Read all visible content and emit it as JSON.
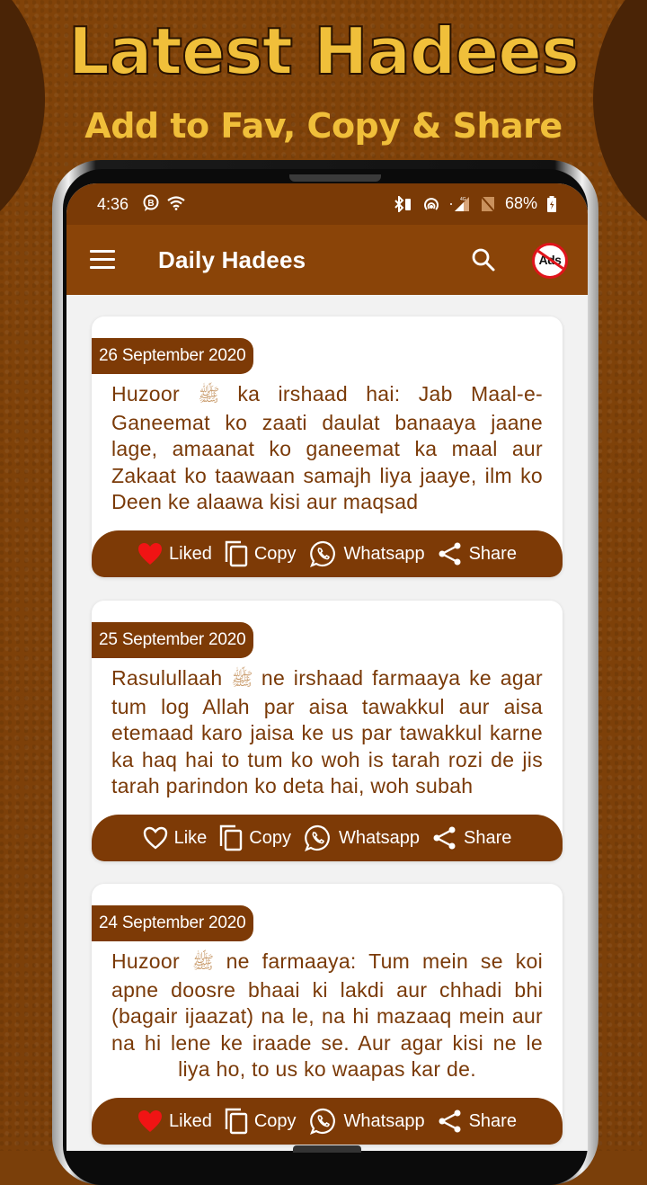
{
  "promo": {
    "title": "Latest Hadees",
    "subtitle": "Add to Fav, Copy & Share"
  },
  "status_bar": {
    "time": "4:36",
    "battery": "68%",
    "left_icons": [
      "chat-bubble-b-icon",
      "wifi-icon"
    ],
    "right_icons": [
      "bluetooth-icon",
      "hotspot-icon",
      "signal-icon",
      "no-sim-icon",
      "battery-charging-icon"
    ]
  },
  "app_bar": {
    "title": "Daily Hadees",
    "menu_icon": "hamburger-menu-icon",
    "search_icon": "search-icon",
    "no_ads_label": "Ads"
  },
  "colors": {
    "primary": "#8a4408",
    "primary_dark": "#7a3a06",
    "text": "#7a3a08",
    "heart_liked": "#f01414",
    "promo_yellow": "#f0bf3a"
  },
  "hadees": [
    {
      "date": "26 September 2020",
      "text_before": "Huzoor",
      "honorific": "ﷺ",
      "text_after": "ka irshaad hai: Jab Maal-e-Ganeemat ko zaati daulat banaaya jaane lage, amaanat ko ganeemat ka maal aur Zakaat ko taawaan samajh liya jaaye, ilm ko Deen ke alaawa kisi aur maqsad",
      "like_label": "Liked",
      "liked": true,
      "copy_label": "Copy",
      "whatsapp_label": "Whatsapp",
      "share_label": "Share"
    },
    {
      "date": "25 September 2020",
      "text_before": "Rasulullaah",
      "honorific": "ﷺ",
      "text_after": "ne irshaad farmaaya ke agar tum log Allah par aisa tawakkul aur aisa etemaad karo jaisa ke us par tawakkul karne ka haq hai to tum ko woh is tarah rozi de jis tarah parindon ko deta hai, woh subah",
      "like_label": "Like",
      "liked": false,
      "copy_label": "Copy",
      "whatsapp_label": "Whatsapp",
      "share_label": "Share"
    },
    {
      "date": "24 September 2020",
      "text_before": "Huzoor",
      "honorific": "ﷺ",
      "text_after": "ne farmaaya: Tum mein se koi apne doosre bhaai ki lakdi aur chhadi bhi (bagair ijaazat) na le, na hi mazaaq mein aur na hi lene ke iraade se. Aur agar kisi ne le liya ho, to us ko waapas kar de.",
      "like_label": "Liked",
      "liked": true,
      "copy_label": "Copy",
      "whatsapp_label": "Whatsapp",
      "share_label": "Share"
    }
  ]
}
